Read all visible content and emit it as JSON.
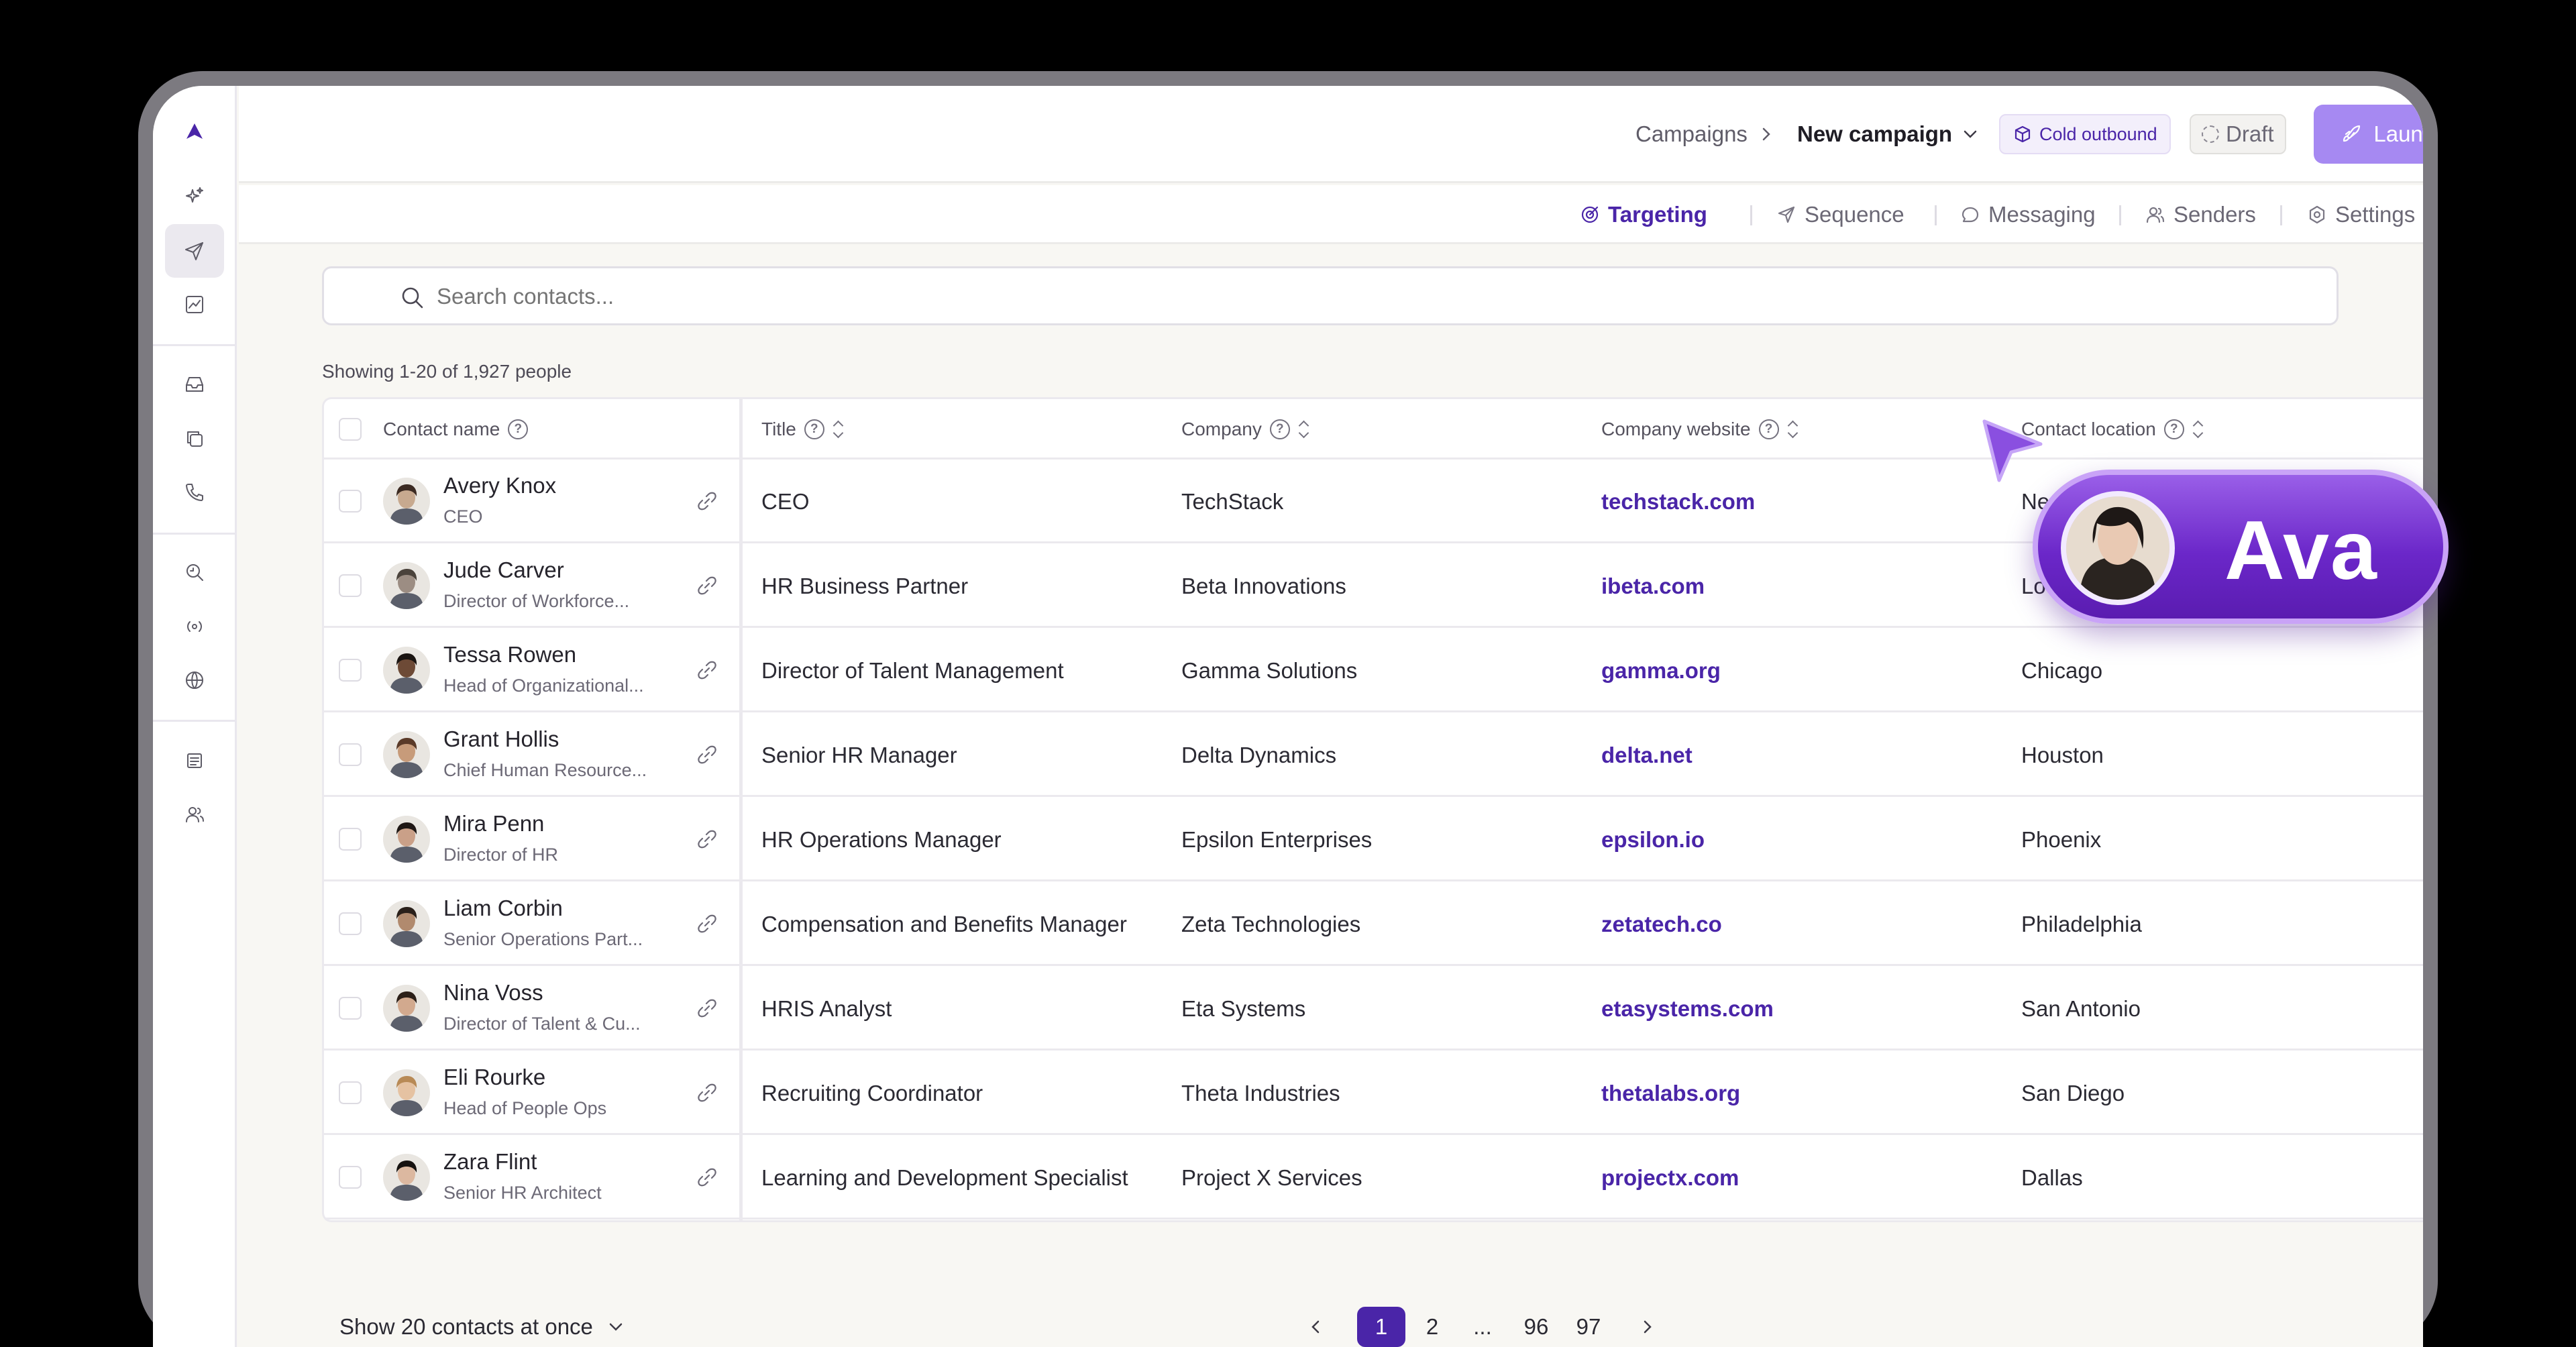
{
  "breadcrumb": {
    "campaigns": "Campaigns",
    "current": "New campaign"
  },
  "tags": {
    "type": "Cold outbound",
    "status": "Draft"
  },
  "launch_label": "Launch",
  "tabs": [
    {
      "label": "Targeting",
      "icon": "target-icon"
    },
    {
      "label": "Sequence",
      "icon": "send-icon"
    },
    {
      "label": "Messaging",
      "icon": "chat-icon"
    },
    {
      "label": "Senders",
      "icon": "users-icon"
    },
    {
      "label": "Settings",
      "icon": "settings-icon"
    }
  ],
  "search": {
    "placeholder": "Search contacts..."
  },
  "summary": "Showing 1-20 of 1,927 people",
  "columns": [
    "Contact name",
    "Title",
    "Company",
    "Company website",
    "Contact location"
  ],
  "rows": [
    {
      "name": "Avery Knox",
      "sub": "CEO",
      "title": "CEO",
      "company": "TechStack",
      "website": "techstack.com",
      "location": "Ne"
    },
    {
      "name": "Jude Carver",
      "sub": "Director of Workforce...",
      "title": "HR Business Partner",
      "company": "Beta Innovations",
      "website": "ibeta.com",
      "location": "Lo"
    },
    {
      "name": "Tessa Rowen",
      "sub": "Head of Organizational...",
      "title": "Director of Talent Management",
      "company": "Gamma Solutions",
      "website": "gamma.org",
      "location": "Chicago"
    },
    {
      "name": "Grant Hollis",
      "sub": "Chief Human Resource...",
      "title": "Senior HR Manager",
      "company": "Delta Dynamics",
      "website": "delta.net",
      "location": "Houston"
    },
    {
      "name": "Mira Penn",
      "sub": "Director of HR",
      "title": "HR Operations Manager",
      "company": "Epsilon Enterprises",
      "website": "epsilon.io",
      "location": "Phoenix"
    },
    {
      "name": "Liam Corbin",
      "sub": "Senior Operations Part...",
      "title": "Compensation and Benefits Manager",
      "company": "Zeta Technologies",
      "website": "zetatech.co",
      "location": "Philadelphia"
    },
    {
      "name": "Nina Voss",
      "sub": "Director of Talent & Cu...",
      "title": "HRIS Analyst",
      "company": "Eta Systems",
      "website": "etasystems.com",
      "location": "San Antonio"
    },
    {
      "name": "Eli Rourke",
      "sub": "Head of People Ops",
      "title": "Recruiting Coordinator",
      "company": "Theta Industries",
      "website": "thetalabs.org",
      "location": "San Diego"
    },
    {
      "name": "Zara Flint",
      "sub": "Senior HR Architect",
      "title": "Learning and Development Specialist",
      "company": "Project X Services",
      "website": "projectx.com",
      "location": "Dallas"
    }
  ],
  "footer": {
    "show_label": "Show 20 contacts at once"
  },
  "pagination": {
    "pages": [
      "1",
      "2",
      "...",
      "96",
      "97"
    ],
    "current": "1"
  },
  "cursor_badge": {
    "name": "Ava"
  },
  "colors": {
    "accent": "#4a25a8",
    "launch": "#a689f2",
    "badge": "#6b27c9"
  }
}
